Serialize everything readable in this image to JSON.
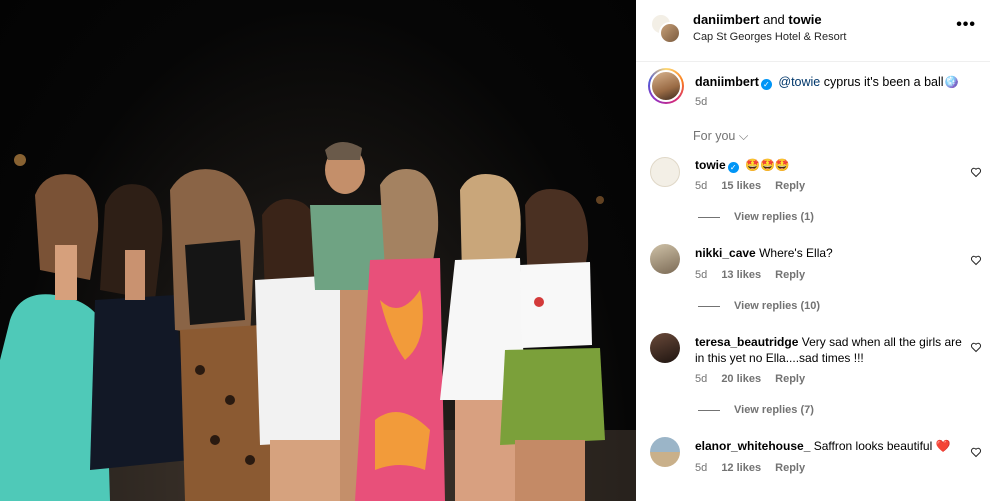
{
  "header": {
    "user1": "daniimbert",
    "joiner": "and",
    "user2": "towie",
    "location": "Cap St Georges Hotel & Resort",
    "more_icon": "•••"
  },
  "caption": {
    "username": "daniimbert",
    "mention": "@towie",
    "text": " cyprus it's been a ball",
    "emoji": "🪩",
    "time": "5d"
  },
  "filter": {
    "label": "For you",
    "chevron": "⌵"
  },
  "comments": [
    {
      "username": "towie",
      "verified": true,
      "text": "🤩🤩🤩",
      "time": "5d",
      "likes": "15 likes",
      "reply": "Reply",
      "view_replies": "View replies (1)"
    },
    {
      "username": "nikki_cave",
      "text": "Where's Ella?",
      "time": "5d",
      "likes": "13 likes",
      "reply": "Reply",
      "view_replies": "View replies (10)"
    },
    {
      "username": "teresa_beautridge",
      "text": "Very sad when all the girls are in this yet no Ella....sad times !!!",
      "time": "5d",
      "likes": "20 likes",
      "reply": "Reply",
      "view_replies": "View replies (7)"
    },
    {
      "username": "elanor_whitehouse_",
      "text": "Saffron looks beautiful",
      "emoji": "❤️",
      "time": "5d",
      "likes": "12 likes",
      "reply": "Reply"
    }
  ],
  "colors": {
    "verified": "#0095f6",
    "mention": "#00376b",
    "muted": "#737373"
  }
}
